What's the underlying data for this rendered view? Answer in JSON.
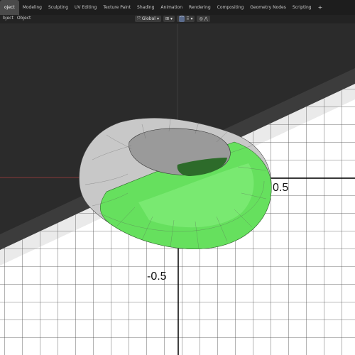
{
  "header": {
    "tabs": [
      "oject",
      "Modeling",
      "Sculpting",
      "UV Editing",
      "Texture Paint",
      "Shading",
      "Animation",
      "Rendering",
      "Compositing",
      "Geometry Nodes",
      "Scripting"
    ],
    "active_tab_index": 0,
    "add_tab": "+"
  },
  "toolbar": {
    "mode_label": "bject",
    "mode_extra": "Object",
    "orientation": "Global"
  },
  "graph": {
    "label_pos": "0.5",
    "label_neg": "-0.5"
  },
  "colors": {
    "torus_green": "#66e05e",
    "torus_grey": "#c8c8c8",
    "viewport_bg": "#2b2b2b",
    "graph_bg": "#ffffff"
  }
}
